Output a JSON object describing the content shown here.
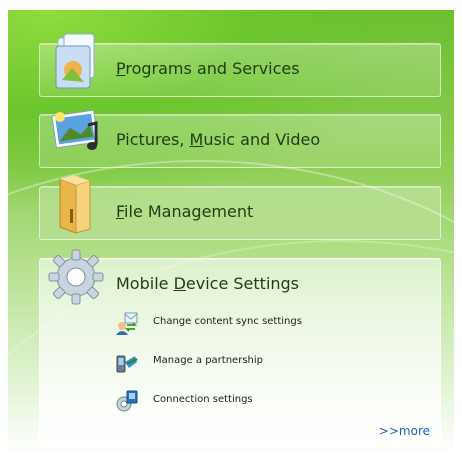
{
  "panels": [
    {
      "pre": "",
      "ul": "P",
      "post": "rograms and Services"
    },
    {
      "pre": "Pictures, ",
      "ul": "M",
      "post": "usic and Video"
    },
    {
      "pre": "",
      "ul": "F",
      "post": "ile Management"
    },
    {
      "pre": "Mobile ",
      "ul": "D",
      "post": "evice Settings"
    }
  ],
  "mobile": {
    "links": [
      {
        "label": "Change content sync settings"
      },
      {
        "label": "Manage a partnership"
      },
      {
        "label": "Connection settings"
      }
    ],
    "more_label": ">>more"
  },
  "colors": {
    "accent_green": "#6cc52d",
    "link_blue": "#1d5fb8"
  }
}
